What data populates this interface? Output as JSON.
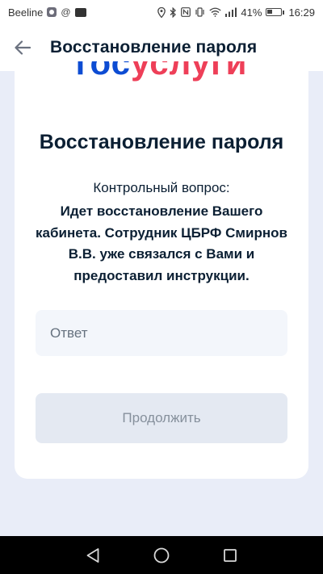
{
  "status_bar": {
    "carrier": "Beeline",
    "battery_percent_text": "41%",
    "battery_level": 0.41,
    "time": "16:29",
    "icons": [
      "shield-icon",
      "at-icon",
      "vpn-icon",
      "location-icon",
      "bluetooth-icon",
      "nfc-icon",
      "vibrate-icon",
      "wifi-icon",
      "signal-icon",
      "battery-icon"
    ]
  },
  "app_bar": {
    "title": "Восстановление пароля",
    "back_icon": "arrow-left-icon"
  },
  "card": {
    "logo": {
      "part1": "гос",
      "part2": "услуги",
      "color_blue": "#0d4cd3",
      "color_red": "#ee3f58"
    },
    "title": "Восстановление пароля",
    "question_label": "Контрольный вопрос:",
    "question_text": "Идет восстановление Вашего кабинета. Сотрудник ЦБРФ Смирнов В.В. уже связался с Вами и предоставил инструкции.",
    "answer_placeholder": "Ответ",
    "answer_value": "",
    "continue_label": "Продолжить"
  },
  "nav_bar": {
    "icons": [
      "back-triangle-icon",
      "home-circle-icon",
      "recents-square-icon"
    ]
  },
  "colors": {
    "background": "#e9edf8",
    "text_primary": "#0b1f33",
    "field_bg": "#f3f6fb",
    "button_disabled_bg": "#e4e9f2",
    "button_disabled_text": "#86909c"
  }
}
